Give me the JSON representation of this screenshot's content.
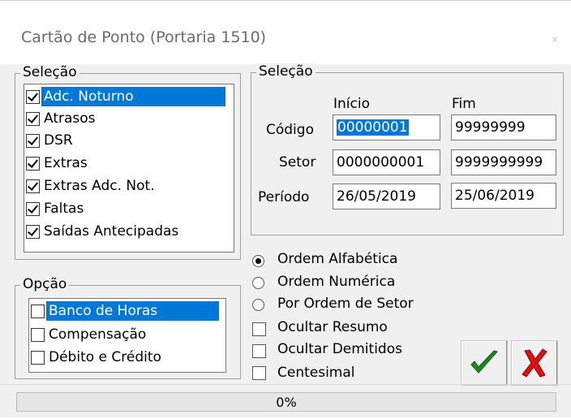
{
  "window": {
    "title": "Cartão de Ponto (Portaria 1510)",
    "close_label": "x"
  },
  "selecao_list": {
    "label": "Seleção",
    "items": [
      {
        "label": "Adc. Noturno",
        "checked": true,
        "selected": true
      },
      {
        "label": "Atrasos",
        "checked": true,
        "selected": false
      },
      {
        "label": "DSR",
        "checked": true,
        "selected": false
      },
      {
        "label": "Extras",
        "checked": true,
        "selected": false
      },
      {
        "label": "Extras Adc. Not.",
        "checked": true,
        "selected": false
      },
      {
        "label": "Faltas",
        "checked": true,
        "selected": false
      },
      {
        "label": "Saídas Antecipadas",
        "checked": true,
        "selected": false
      }
    ]
  },
  "opcao_list": {
    "label": "Opção",
    "items": [
      {
        "label": "Banco de Horas",
        "checked": false,
        "selected": true
      },
      {
        "label": "Compensação",
        "checked": false,
        "selected": false
      },
      {
        "label": "Débito e Crédito",
        "checked": false,
        "selected": false
      }
    ]
  },
  "range": {
    "label": "Seleção",
    "col_start": "Início",
    "col_end": "Fim",
    "rows": [
      {
        "label": "Código",
        "start": "00000001",
        "end": "99999999"
      },
      {
        "label": "Setor",
        "start": "0000000001",
        "end": "9999999999"
      },
      {
        "label": "Período",
        "start": "26/05/2019",
        "end": "25/06/2019"
      }
    ]
  },
  "order_options": [
    {
      "label": "Ordem Alfabética",
      "checked": true
    },
    {
      "label": "Ordem Numérica",
      "checked": false
    },
    {
      "label": "Por Ordem de Setor",
      "checked": false
    }
  ],
  "flags": [
    {
      "label": "Ocultar Resumo",
      "checked": false
    },
    {
      "label": "Ocultar Demitidos",
      "checked": false
    },
    {
      "label": "Centesimal",
      "checked": false
    }
  ],
  "buttons": {
    "confirm_icon": "checkmark-icon",
    "cancel_icon": "cross-icon",
    "confirm_color": "#1a8a1a",
    "cancel_color": "#e01010"
  },
  "progress": {
    "text": "0%",
    "value": 0
  }
}
